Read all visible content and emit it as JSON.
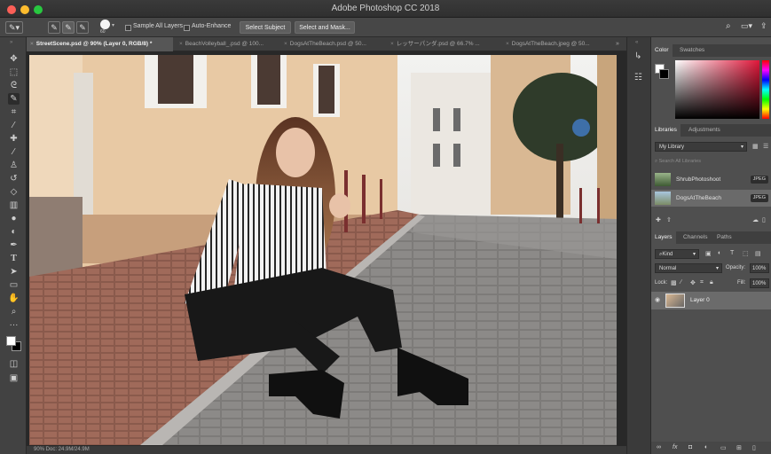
{
  "window": {
    "title": "Adobe Photoshop CC 2018"
  },
  "colors": {
    "close": "#fc5f57",
    "minimize": "#fdbc2e",
    "zoom": "#28c840",
    "accent": "#5b9bd5"
  },
  "options_bar": {
    "brush_size": "60",
    "sample_all_layers": "Sample All Layers",
    "auto_enhance": "Auto-Enhance",
    "select_subject": "Select Subject",
    "select_and_mask": "Select and Mask..."
  },
  "tabs": [
    {
      "label": "StreetScene.psd @ 90% (Layer 0, RGB/8) *"
    },
    {
      "label": "BeachVolleyball_.psd @ 100..."
    },
    {
      "label": "DogsAtTheBeach.psd @ 50..."
    },
    {
      "label": "レッサーパンダ.psd @ 66.7% ..."
    },
    {
      "label": "DogsAtTheBeach.jpeg @ 50..."
    }
  ],
  "tools": [
    "move-tool",
    "marquee-tool",
    "lasso-tool",
    "quick-selection-tool",
    "crop-tool",
    "eyedropper-tool",
    "healing-brush-tool",
    "brush-tool",
    "clone-stamp-tool",
    "history-brush-tool",
    "eraser-tool",
    "gradient-tool",
    "blur-tool",
    "dodge-tool",
    "pen-tool",
    "type-tool",
    "path-selection-tool",
    "shape-tool",
    "hand-tool",
    "zoom-tool",
    "more-tools"
  ],
  "color_panel": {
    "tabs": [
      "Color",
      "Swatches"
    ]
  },
  "libraries_panel": {
    "tabs": [
      "Libraries",
      "Adjustments"
    ],
    "library_name": "My Library",
    "search_placeholder": "Search All Libraries",
    "items": [
      {
        "name": "ShrubPhotoshoot",
        "badge": "JPEG"
      },
      {
        "name": "DogsAtTheBeach",
        "badge": "JPEG"
      }
    ]
  },
  "layers_panel": {
    "tabs": [
      "Layers",
      "Channels",
      "Paths"
    ],
    "kind": "Kind",
    "blend_mode": "Normal",
    "opacity_label": "Opacity:",
    "opacity_value": "100%",
    "lock_label": "Lock:",
    "fill_label": "Fill:",
    "fill_value": "100%",
    "layer_name": "Layer 0"
  },
  "status": {
    "text": "90%      Doc: 24.9M/24.9M"
  }
}
